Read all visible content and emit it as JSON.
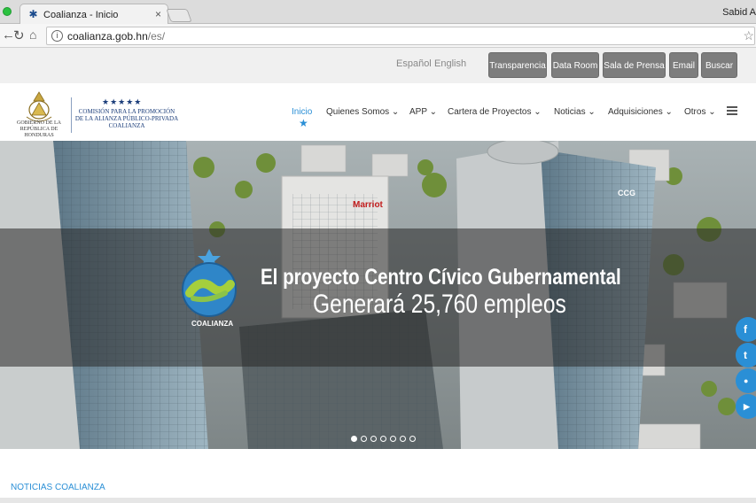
{
  "browser": {
    "tab_title": "Coalianza - Inicio",
    "tab_close": "×",
    "user": "Sabid A",
    "url_host": "coalianza.gob.hn",
    "url_path": "/es/"
  },
  "util": {
    "lang_es": "Español",
    "lang_en": "English",
    "buttons": [
      "Transparencia",
      "Data Room",
      "Sala de Prensa",
      "Email",
      "Buscar"
    ]
  },
  "logo": {
    "stars": "★★★★★",
    "text": "COMISIÓN PARA LA PROMOCIÓN DE LA ALIANZA PÚBLICO-PRIVADA COALIANZA",
    "seal_caption": "GOBIERNO DE LA REPÚBLICA DE HONDURAS"
  },
  "nav": {
    "items": [
      {
        "label": "Inicio"
      },
      {
        "label": "Quienes Somos ⌄"
      },
      {
        "label": "APP ⌄"
      },
      {
        "label": "Cartera de Proyectos ⌄"
      },
      {
        "label": "Noticias ⌄"
      },
      {
        "label": "Adquisiciones ⌄"
      },
      {
        "label": "Otros ⌄"
      }
    ]
  },
  "hero": {
    "title": "El proyecto Centro Cívico Gubernamental",
    "subtitle": "Generará 25,760 empleos",
    "logo_text": "COALIANZA",
    "sign_text": "Marriot",
    "ccg_text": "CCG",
    "slides": 7,
    "active_slide": 0
  },
  "social": {
    "facebook": "f",
    "twitter": "t",
    "periscope": "●",
    "youtube": "▶"
  },
  "section": {
    "title": "NOTICIAS COALIANZA"
  },
  "colors": {
    "accent": "#2a8fd6",
    "util_button": "#7d7d7d",
    "logo_blue": "#1b3d7a"
  }
}
